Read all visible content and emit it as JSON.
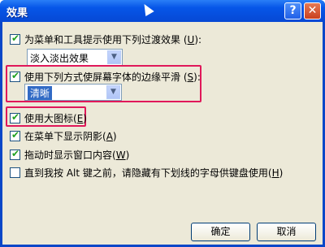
{
  "title": "效果",
  "titlebar": {
    "help": "?",
    "close": "✕"
  },
  "menu_effect": {
    "label": "为菜单和工具提示使用下列过渡效果",
    "hotkey": "U",
    "select": "淡入淡出效果"
  },
  "font_smooth": {
    "label": "使用下列方式使屏幕字体的边缘平滑",
    "hotkey": "S",
    "select": "清晰"
  },
  "options": [
    {
      "label": "使用大图标",
      "hotkey": "E"
    },
    {
      "label": "在菜单下显示阴影",
      "hotkey": "A"
    },
    {
      "label": "拖动时显示窗口内容",
      "hotkey": "W"
    },
    {
      "label": "直到我按 Alt 键之前，请隐藏有下划线的字母供键盘使用",
      "hotkey": "H"
    }
  ],
  "buttons": {
    "ok": "确定",
    "cancel": "取消"
  },
  "colors": {
    "highlight_box": "#e0185a",
    "titlebar": "#0656e8",
    "dialog_bg": "#ece9d8"
  },
  "icons": {
    "check": "✔",
    "dropdown": "▼"
  }
}
